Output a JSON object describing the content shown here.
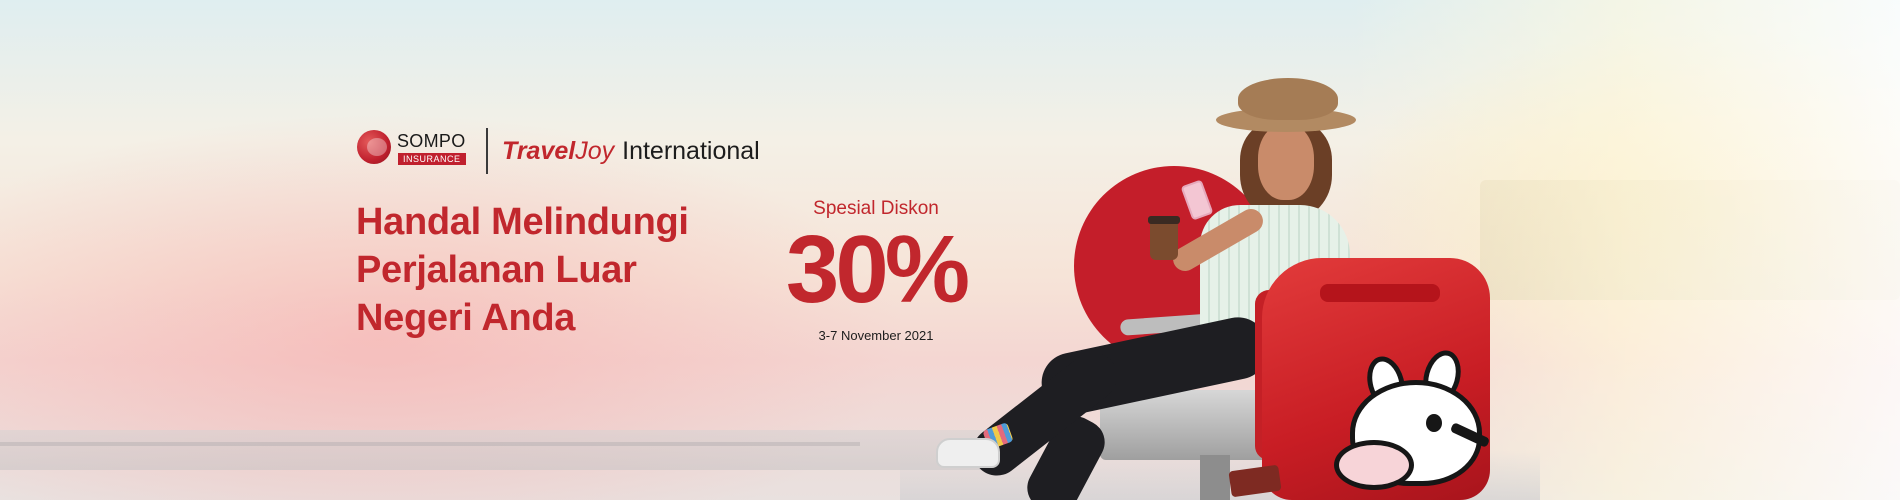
{
  "brand": {
    "sompo_name": "SOMPO",
    "sompo_tagline": "INSURANCE",
    "product_part1": "Travel",
    "product_part2": "Joy",
    "product_part3": "International"
  },
  "headline": {
    "line1": "Handal Melindungi",
    "line2": "Perjalanan Luar",
    "line3": "Negeri Anda"
  },
  "promo": {
    "label": "Spesial Diskon",
    "value": "30%",
    "date": "3-7 November 2021"
  },
  "colors": {
    "brand_red": "#c1272d",
    "text_dark": "#1d1d1d"
  }
}
